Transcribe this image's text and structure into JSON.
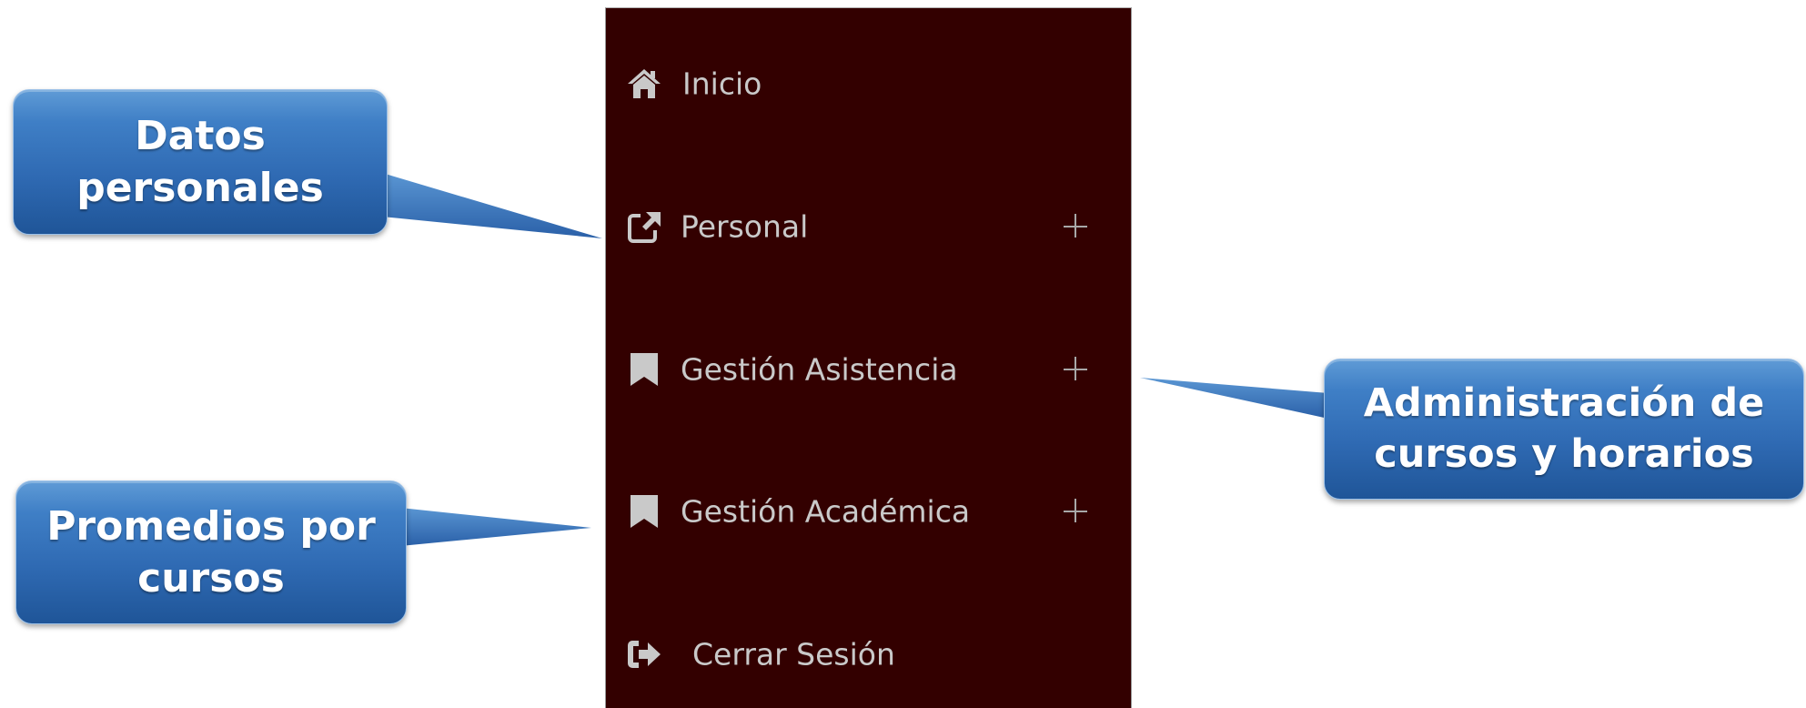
{
  "sidebar": {
    "background": "#330000",
    "items": [
      {
        "label": "Inicio",
        "icon": "home-icon",
        "expandable": false
      },
      {
        "label": "Personal",
        "icon": "external-link-icon",
        "expandable": true
      },
      {
        "label": "Gestión Asistencia",
        "icon": "bookmark-icon",
        "expandable": true
      },
      {
        "label": "Gestión Académica",
        "icon": "bookmark-icon",
        "expandable": true
      },
      {
        "label": "Cerrar Sesión",
        "icon": "sign-out-icon",
        "expandable": false
      }
    ]
  },
  "callouts": {
    "datos_personales": {
      "line1": "Datos",
      "line2": "personales"
    },
    "promedios": {
      "line1": "Promedios por",
      "line2": "cursos"
    },
    "administracion": {
      "line1": "Administración de",
      "line2": "cursos y horarios"
    }
  },
  "colors": {
    "callout_blue": "#2f6ab3",
    "menu_text": "#c9c9c9",
    "menu_background": "#330000"
  }
}
